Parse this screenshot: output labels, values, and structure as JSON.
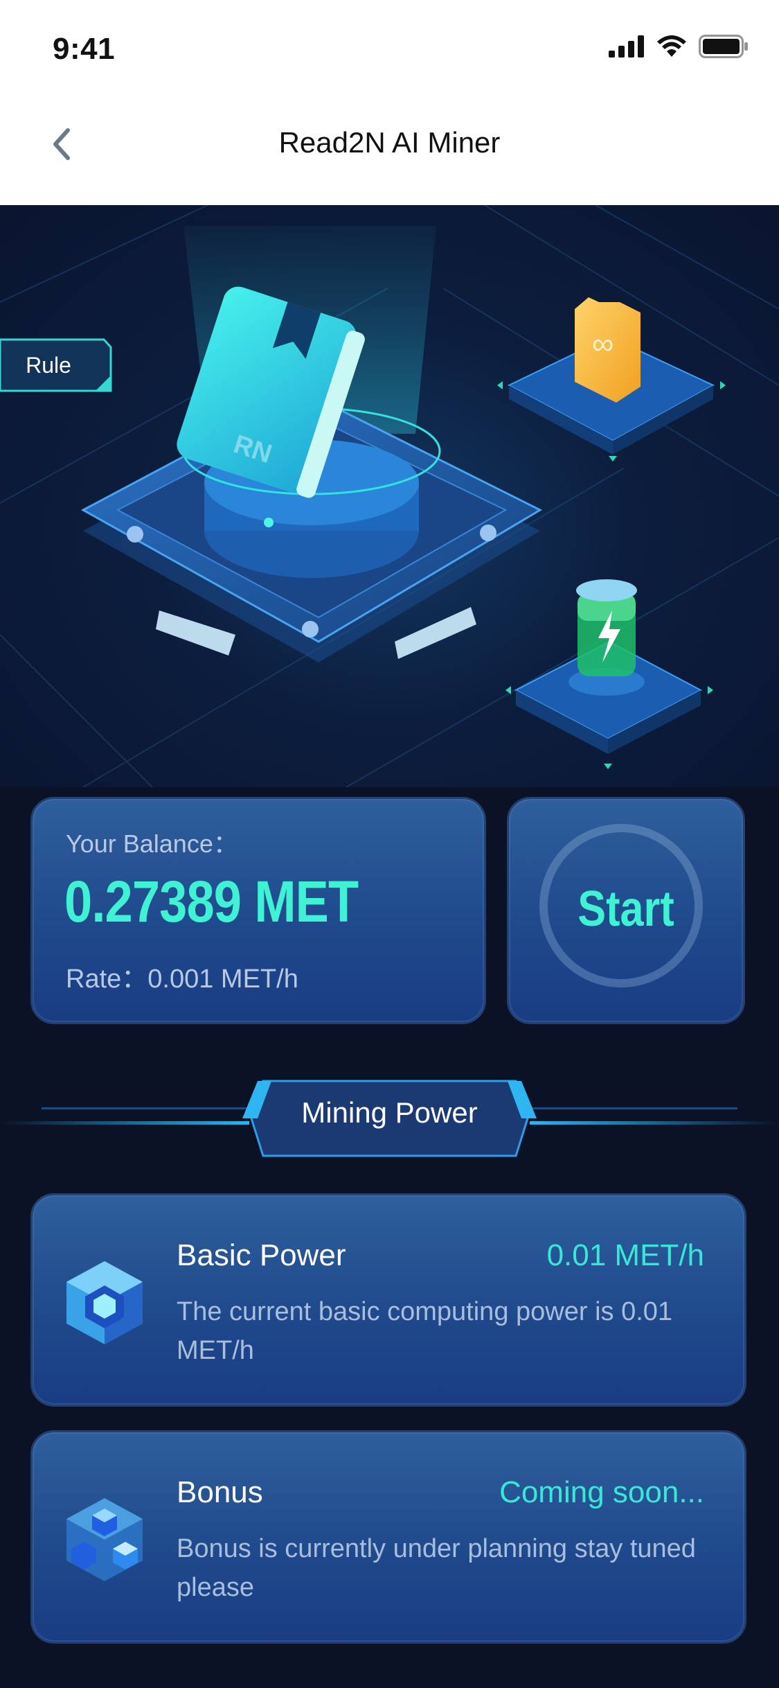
{
  "status_bar": {
    "time": "9:41"
  },
  "nav": {
    "title": "Read2N AI Miner",
    "back_icon": "chevron-left-icon"
  },
  "hero": {
    "rule_label": "Rule"
  },
  "balance": {
    "label": "Your Balance：",
    "value": "0.27389 MET",
    "rate": "Rate：0.001 MET/h"
  },
  "start_button": {
    "label": "Start"
  },
  "section": {
    "title": "Mining Power"
  },
  "power_items": [
    {
      "title": "Basic Power",
      "value": "0.01 MET/h",
      "description": "The current basic computing power is 0.01 MET/h",
      "icon": "cube-icon"
    },
    {
      "title": "Bonus",
      "value": "Coming soon...",
      "description": "Bonus is currently under planning stay tuned please",
      "icon": "cubes-icon"
    }
  ],
  "colors": {
    "accent": "#3ff2d4",
    "card": "#1f4a8c",
    "background": "#0b1226"
  }
}
